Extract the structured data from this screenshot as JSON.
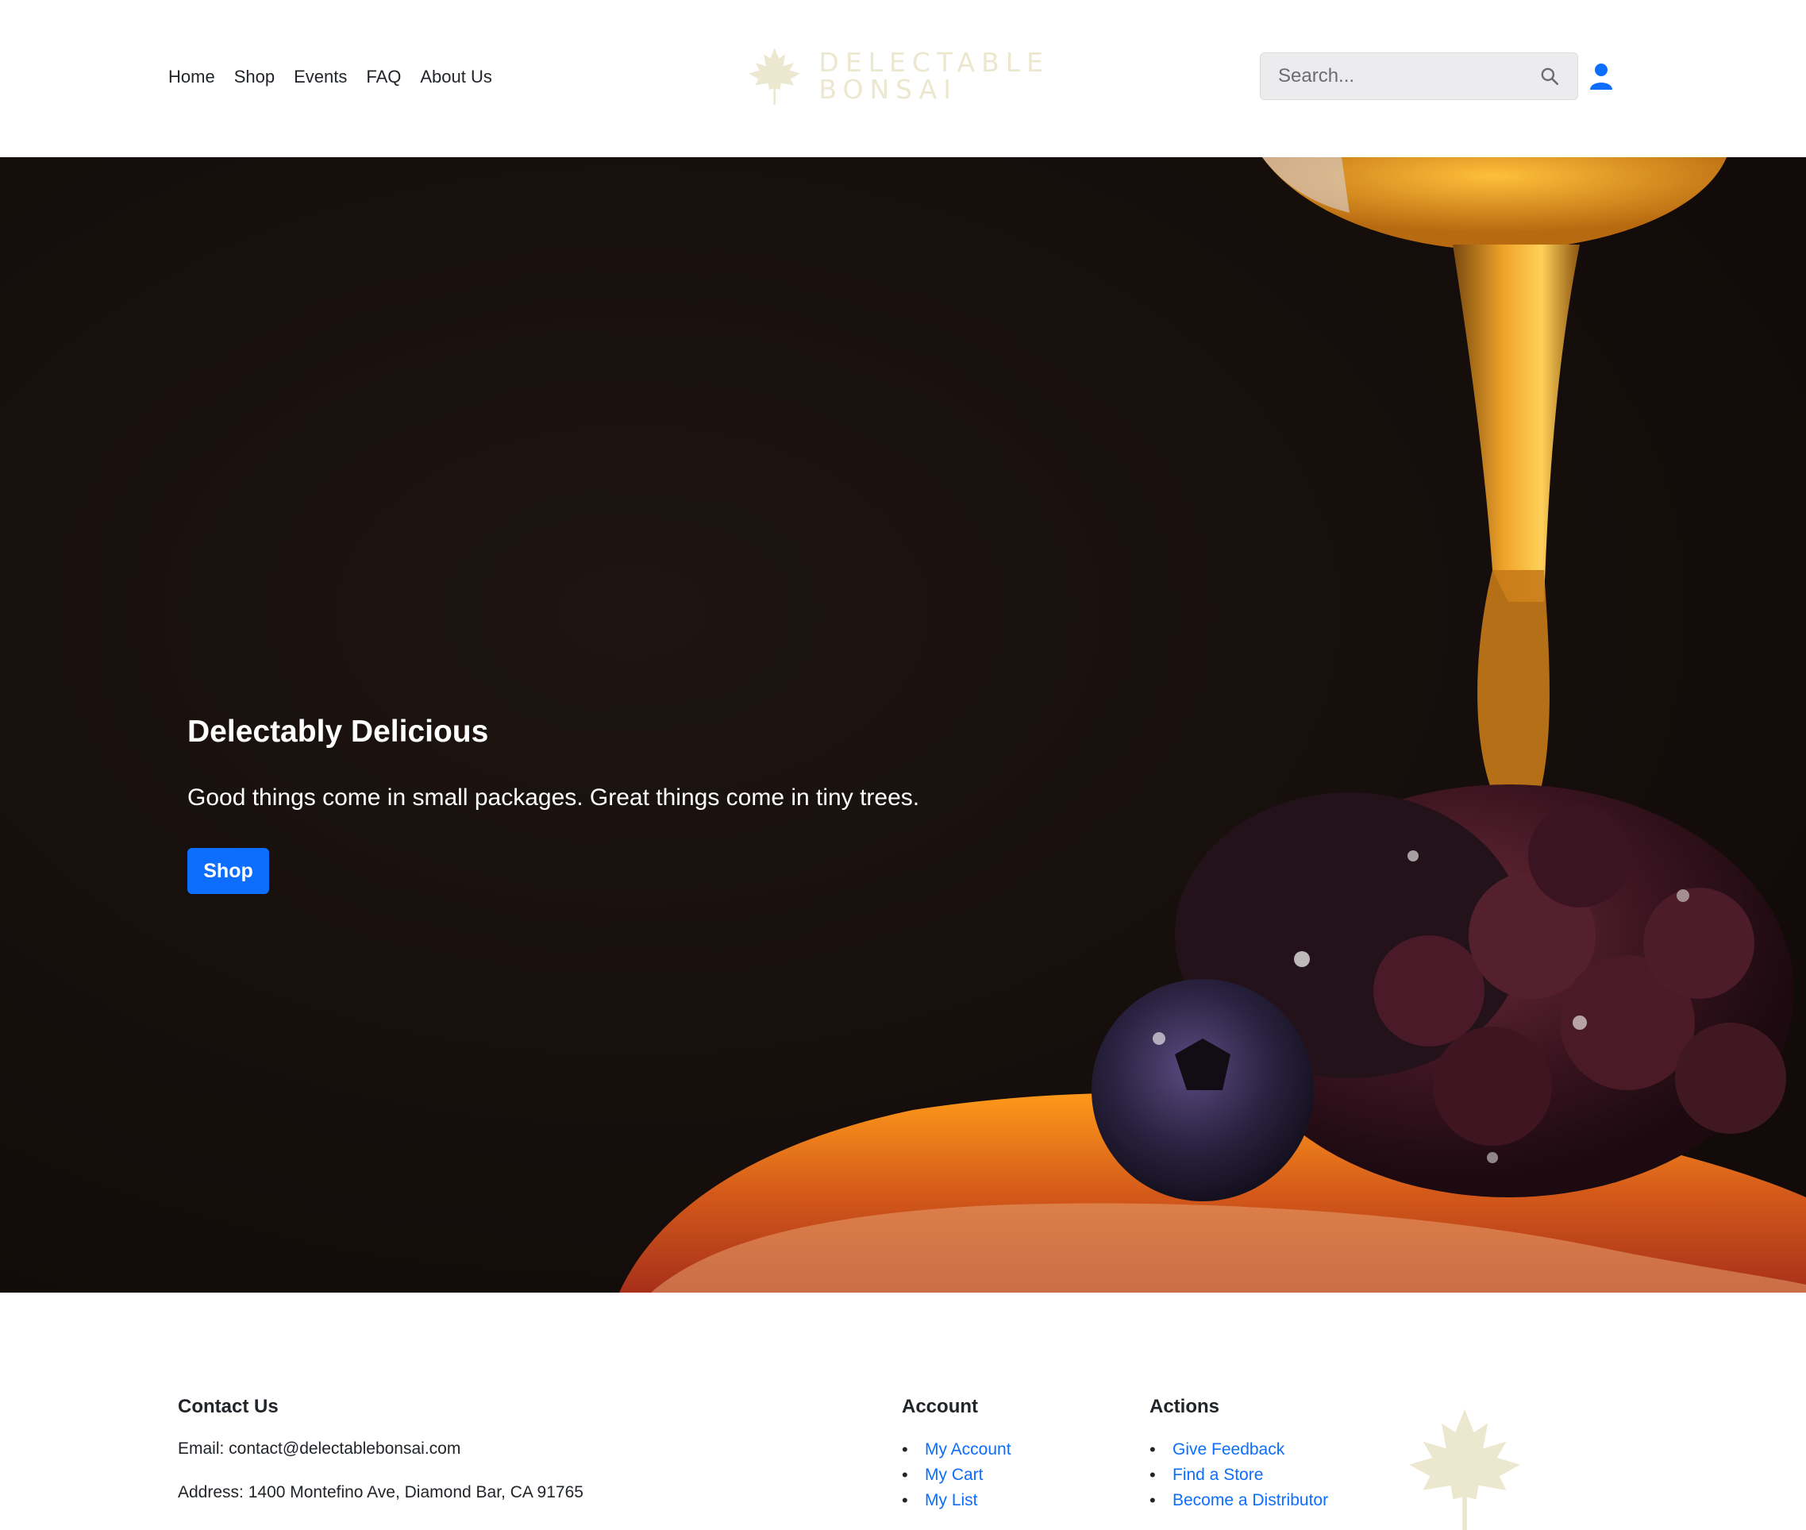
{
  "header": {
    "nav": [
      "Home",
      "Shop",
      "Events",
      "FAQ",
      "About Us"
    ],
    "brand": {
      "line1": "DELECTABLE",
      "line2": "BONSAI",
      "logo_icon": "maple-leaf-icon"
    },
    "search": {
      "placeholder": "Search...",
      "icon": "search-icon"
    },
    "user_icon": "user-icon"
  },
  "hero": {
    "title": "Delectably Delicious",
    "subtitle": "Good things come in small packages. Great things come in tiny trees.",
    "button_label": "Shop"
  },
  "footer": {
    "contact": {
      "title": "Contact Us",
      "email": "Email: contact@delectablebonsai.com",
      "address": "Address: 1400 Montefino Ave, Diamond Bar, CA 91765"
    },
    "account": {
      "title": "Account",
      "links": [
        "My Account",
        "My Cart",
        "My List"
      ]
    },
    "actions": {
      "title": "Actions",
      "links": [
        "Give Feedback",
        "Find a Store",
        "Become a Distributor"
      ]
    }
  },
  "colors": {
    "accent": "#0d6efd",
    "brand_cream": "#ece7cf",
    "hero_bg": "#160e0b"
  }
}
